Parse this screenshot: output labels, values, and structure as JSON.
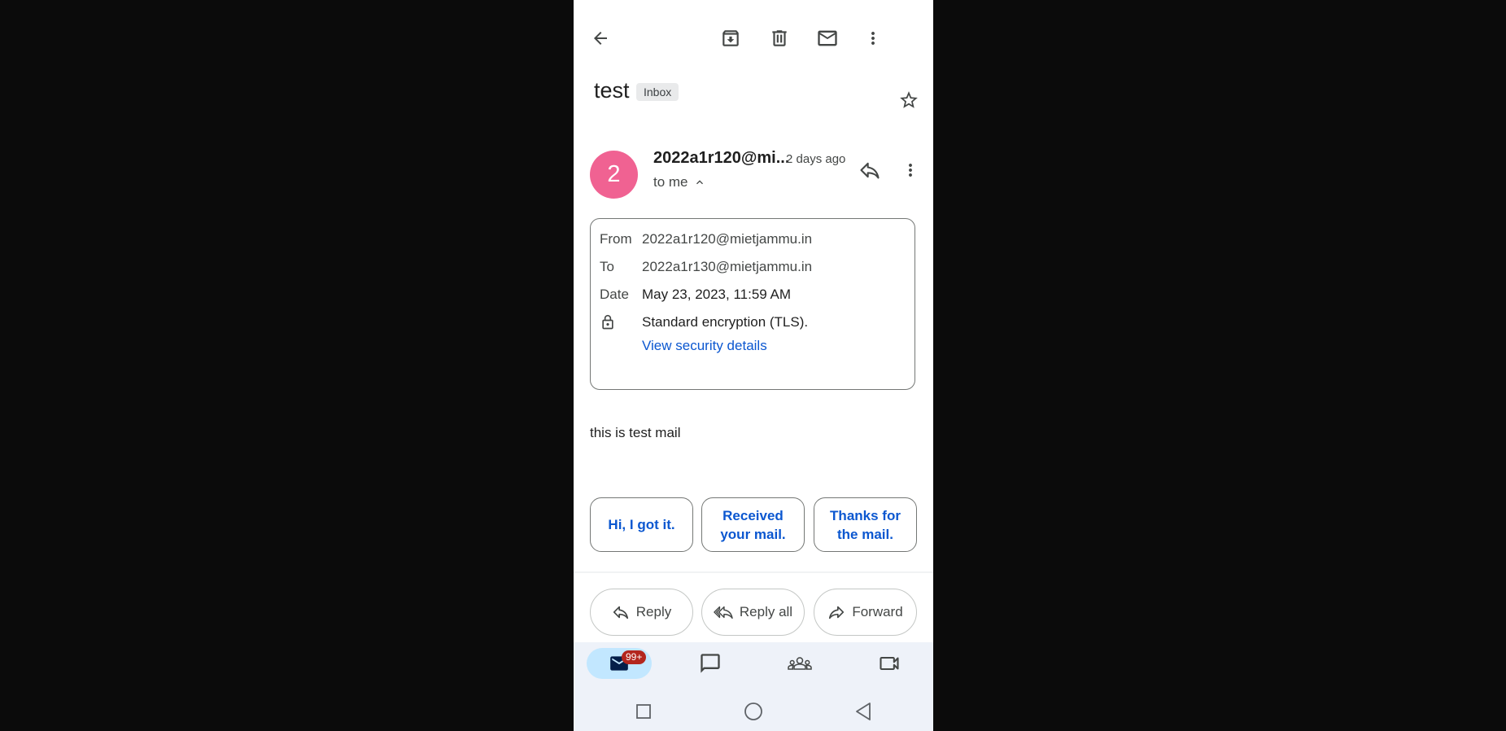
{
  "subject": {
    "title": "test",
    "label_chip": "Inbox"
  },
  "sender": {
    "avatar_letter": "2",
    "avatar_color": "#f06292",
    "name": "2022a1r120@mi...",
    "time": "2 days ago",
    "recipient_summary": "to me"
  },
  "details": {
    "from_label": "From",
    "from_value": "2022a1r120@mietjammu.in",
    "to_label": "To",
    "to_value": "2022a1r130@mietjammu.in",
    "date_label": "Date",
    "date_value": "May 23, 2023, 11:59 AM",
    "security_text": "Standard encryption (TLS).",
    "security_link": "View security details"
  },
  "body": "this is test mail",
  "smart_replies": [
    "Hi, I got it.",
    "Received your mail.",
    "Thanks for the mail."
  ],
  "actions": {
    "reply": "Reply",
    "reply_all": "Reply all",
    "forward": "Forward"
  },
  "bottom_nav": {
    "mail_badge": "99+"
  },
  "colors": {
    "accent": "#0b57d0",
    "badge": "#b3261e",
    "nav_active": "#c2e7ff"
  },
  "icons": {
    "top_bar": [
      "back-arrow-icon",
      "archive-icon",
      "delete-icon",
      "mark-unread-icon",
      "more-vert-icon"
    ],
    "bottom_nav": [
      "mail-icon",
      "chat-icon",
      "spaces-icon",
      "meet-icon"
    ],
    "system": [
      "recents-square-icon",
      "home-circle-icon",
      "back-triangle-icon"
    ]
  }
}
